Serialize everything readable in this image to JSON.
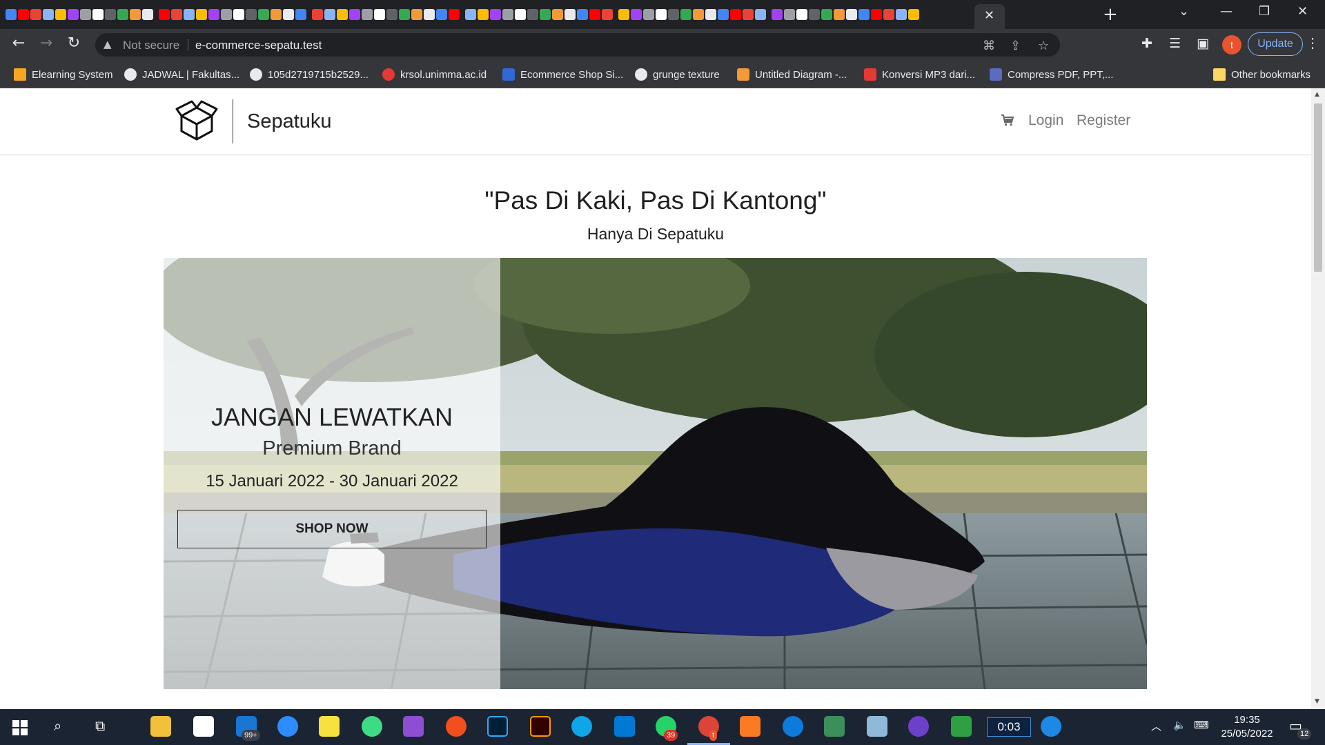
{
  "browser": {
    "not_secure_label": "Not secure",
    "url": "e-commerce-sepatu.test",
    "update_label": "Update",
    "profile_initial": "t",
    "new_tab_symbol": "+",
    "close_tab_symbol": "✕",
    "window_minimize": "—",
    "window_restore": "❐",
    "window_close": "✕",
    "chevron_down": "⌄"
  },
  "bookmarks": [
    {
      "label": "Elearning System",
      "icon_color": "#f5a623"
    },
    {
      "label": "JADWAL | Fakultas...",
      "icon_color": "#e8eaed"
    },
    {
      "label": "105d2719715b2529...",
      "icon_color": "#e8eaed"
    },
    {
      "label": "krsol.unimma.ac.id",
      "icon_color": "#e53935"
    },
    {
      "label": "Ecommerce Shop Si...",
      "icon_color": "#3367d6"
    },
    {
      "label": "grunge texture",
      "icon_color": "#e8eaed"
    },
    {
      "label": "Untitled Diagram -...",
      "icon_color": "#f29a38"
    },
    {
      "label": "Konversi MP3 dari...",
      "icon_color": "#e53935"
    },
    {
      "label": "Compress PDF, PPT,...",
      "icon_color": "#5c6bc0"
    }
  ],
  "other_bookmarks_label": "Other bookmarks",
  "site": {
    "brand": "Sepatuku",
    "nav": {
      "login": "Login",
      "register": "Register"
    }
  },
  "hero": {
    "title": "\"Pas Di Kaki, Pas Di Kantong\"",
    "subtitle": "Hanya Di Sepatuku"
  },
  "promo": {
    "headline": "JANGAN LEWATKAN",
    "brand": "Premium Brand",
    "dates": "15 Januari 2022 - 30 Januari 2022",
    "cta": "SHOP NOW"
  },
  "taskbar": {
    "mail_badge": "99+",
    "whatsapp_badge": "39",
    "chrome_badge": "t",
    "timer": "0:03",
    "time": "19:35",
    "date": "25/05/2022",
    "notification_count": "12"
  },
  "colors": {
    "chrome_dark": "#202124",
    "chrome_toolbar": "#35363a",
    "update_accent": "#8ab4f8",
    "taskbar": "#1b2433",
    "text_dark": "#222222",
    "nav_link": "#7b7b7b"
  }
}
